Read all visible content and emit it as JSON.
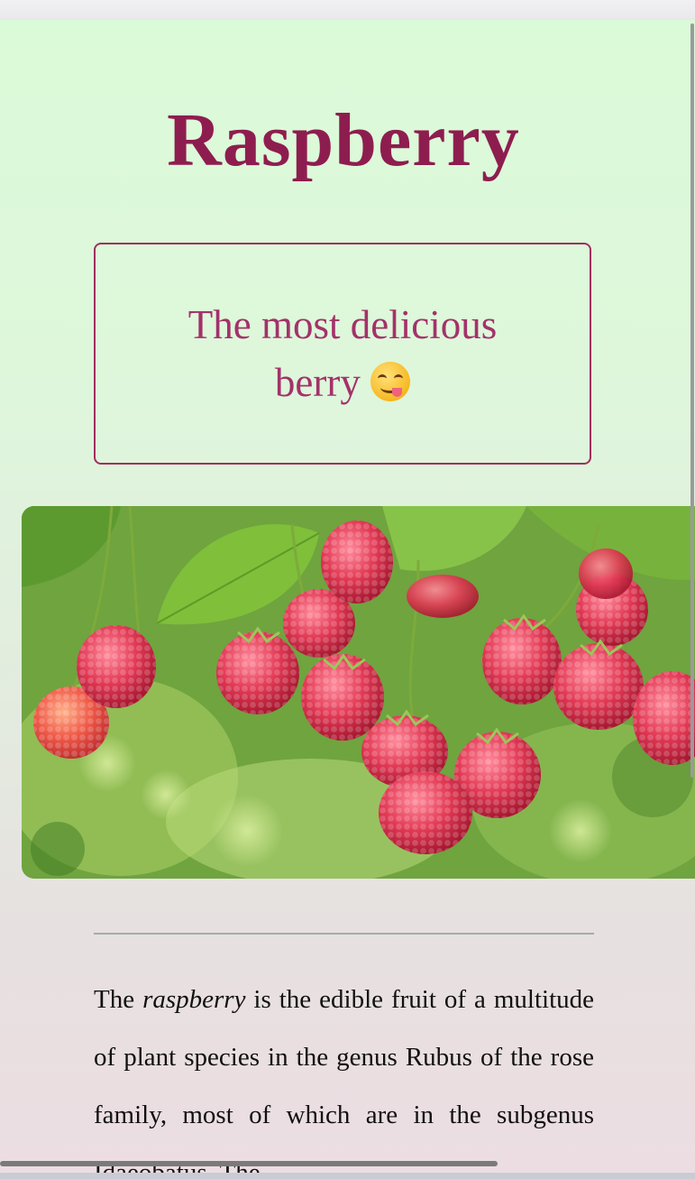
{
  "page": {
    "title": "Raspberry",
    "tagline": "The most delicious berry",
    "tagline_emoji": "face-savoring-food-emoji",
    "hero_image": "raspberries-on-branch-photo",
    "paragraph": {
      "before": "The ",
      "emphasis": "raspberry",
      "after": " is the edible fruit of a multitude of plant species in the genus Rubus of the rose family, most of which are in the subgenus Idaeobatus. The"
    }
  },
  "colors": {
    "title": "#8e1d4f",
    "accent": "#a3326a",
    "background_top": "#dbfad8",
    "background_bottom": "#ecdde2"
  }
}
